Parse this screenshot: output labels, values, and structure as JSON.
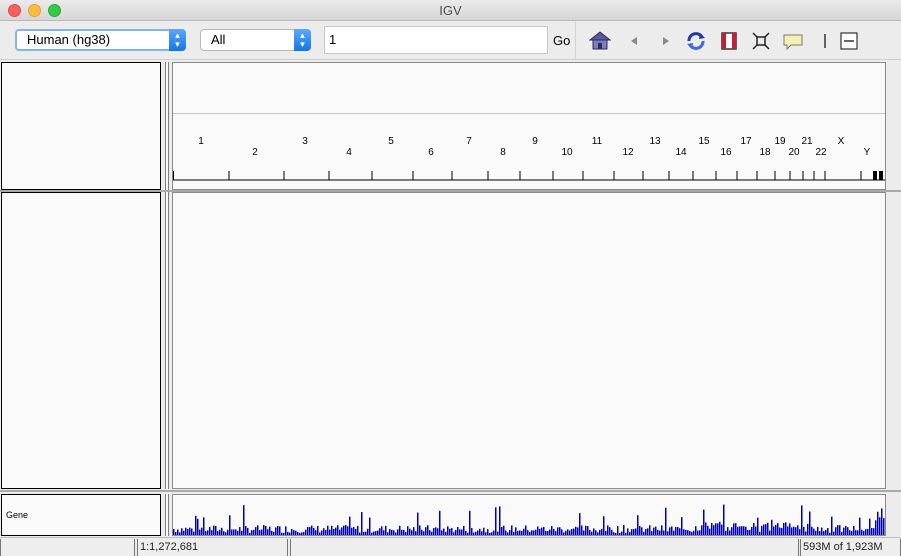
{
  "window": {
    "title": "IGV"
  },
  "toolbar": {
    "genome": "Human (hg38)",
    "chromosome": "All",
    "locus": "1",
    "go_label": "Go",
    "icons": [
      "home-icon",
      "back-icon",
      "forward-icon",
      "refresh-icon",
      "roi-icon",
      "fit-to-window-icon",
      "popup-info-icon",
      "ruler-toggle-icon",
      "zoom-out-icon"
    ]
  },
  "ruler": {
    "chromosomes": [
      "1",
      "2",
      "3",
      "4",
      "5",
      "6",
      "7",
      "8",
      "9",
      "10",
      "11",
      "12",
      "13",
      "14",
      "15",
      "16",
      "17",
      "18",
      "19",
      "20",
      "21",
      "22",
      "X",
      "Y"
    ]
  },
  "tracks": {
    "feature_track_name": "Gene",
    "feature_color": "#0000b2"
  },
  "status": {
    "position": "1:1,272,681",
    "memory": "593M of 1,923M"
  },
  "colors": {
    "close": "#fc605c",
    "minimize": "#fdbc40",
    "maximize": "#34c84a",
    "accent": "#1474e8"
  }
}
